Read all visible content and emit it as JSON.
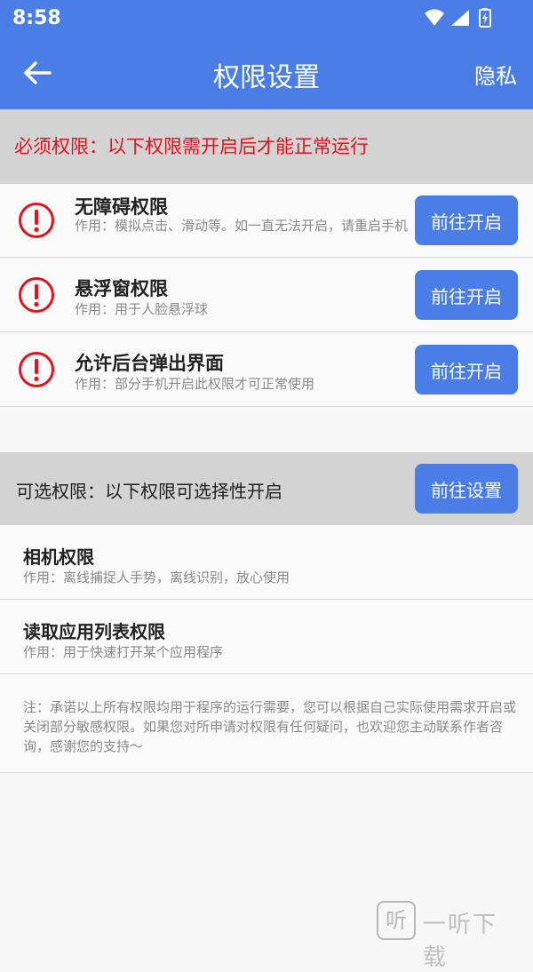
{
  "status_bar": {
    "time": "8:58"
  },
  "app_bar": {
    "title": "权限设置",
    "privacy_label": "隐私"
  },
  "required": {
    "header": "必须权限：以下权限需开启后才能正常运行",
    "items": [
      {
        "name": "无障碍权限",
        "desc": "作用：模拟点击、滑动等。如一直无法开启，请重启手机",
        "button": "前往开启"
      },
      {
        "name": "悬浮窗权限",
        "desc": "作用：用于人脸悬浮球",
        "button": "前往开启"
      },
      {
        "name": "允许后台弹出界面",
        "desc": "作用：部分手机开启此权限才可正常使用",
        "button": "前往开启"
      }
    ]
  },
  "optional": {
    "header": "可选权限：以下权限可选择性开启",
    "button": "前往设置",
    "items": [
      {
        "name": "相机权限",
        "desc": "作用：离线捕捉人手势，离线识别，放心使用"
      },
      {
        "name": "读取应用列表权限",
        "desc": "作用：用于快速打开某个应用程序"
      }
    ]
  },
  "note": "注：承诺以上所有权限均用于程序的运行需要，您可以根据自己实际使用需求开启或关闭部分敏感权限。如果您对所申请对权限有任何疑问，也欢迎您主动联系作者咨询，感谢您的支持～",
  "watermark": {
    "glyph": "听",
    "text": "一听下载"
  },
  "colors": {
    "primary": "#4a7ee6",
    "warning": "#e0141e",
    "section_bg": "#d3d3d3"
  }
}
